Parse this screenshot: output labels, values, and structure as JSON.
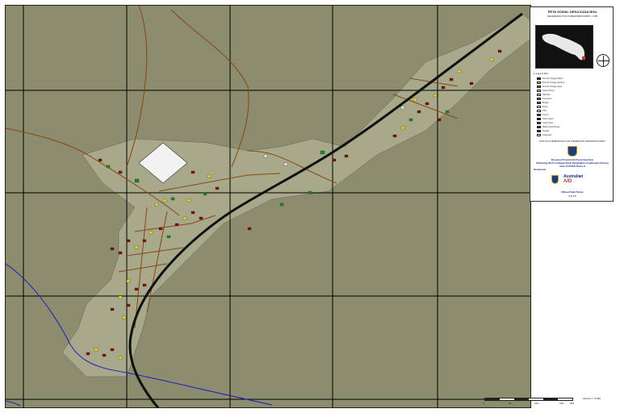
{
  "map": {
    "title": "PETA SOSIAL DESA KASA BOU",
    "subtitle": "KECAMATAN PUTU KABUPATEN DOMPU - NTB",
    "legend_heading": "L e g e n d a :",
    "legend_items": [
      {
        "label": "Rumah Tangga Miskin",
        "color": "#8b0000"
      },
      {
        "label": "Rumah Tangga Sedang",
        "color": "#f2e600"
      },
      {
        "label": "Rumah Tangga Kaya",
        "color": "#1a8a1a"
      },
      {
        "label": "Kantor Desa",
        "color": "#dddddd"
      },
      {
        "label": "Sekolah",
        "color": "#dddddd"
      },
      {
        "label": "Posyandu",
        "color": "#a83232"
      },
      {
        "label": "Masjid",
        "color": "#555555"
      },
      {
        "label": "Pustu",
        "color": "#ffffff"
      },
      {
        "label": "TPA",
        "color": "#ffffff"
      },
      {
        "label": "Sumur",
        "color": "#555555"
      },
      {
        "label": "Jalan Aspal",
        "color": "#111111"
      },
      {
        "label": "Jalan Desa",
        "color": "#8b4513"
      },
      {
        "label": "Batas Administrasi",
        "color": "#333333"
      },
      {
        "label": "Sungai",
        "color": "#1e1ebe"
      },
      {
        "label": "Lapangan",
        "color": "#ffffff"
      }
    ],
    "source_line": "PETA INI DI KEMBANGKAN OLEH PEMERINTAH KABUPATEN DOMPU",
    "cooperation_lines": [
      "Bersama Pemerintah Desa Kasa Bou",
      "Didukung Oleh Lembaga Studi Pengkajian Lingkungan Dompu",
      "Atas ACCESS Phase II"
    ],
    "cooperation_label": "Kerjasama",
    "sponsor_name": "Australian",
    "sponsor_suffix": "AID",
    "made_label": "Dibuat Pada Tahun",
    "year": "2 0 1 2",
    "scale_title": "SKALA 1 : 5.000",
    "scale_labels": [
      "0",
      "50",
      "100",
      "150",
      "200"
    ],
    "colors": {
      "land": "#8c8c6e",
      "village": "#a8a88a",
      "main_road": "#111111",
      "local_road": "#8b4513",
      "river": "#1e1ebe",
      "grid": "#000000",
      "poor": "#8b0000",
      "medium": "#f2e600",
      "rich": "#1a8a1a",
      "building": "#eeeeee"
    }
  }
}
